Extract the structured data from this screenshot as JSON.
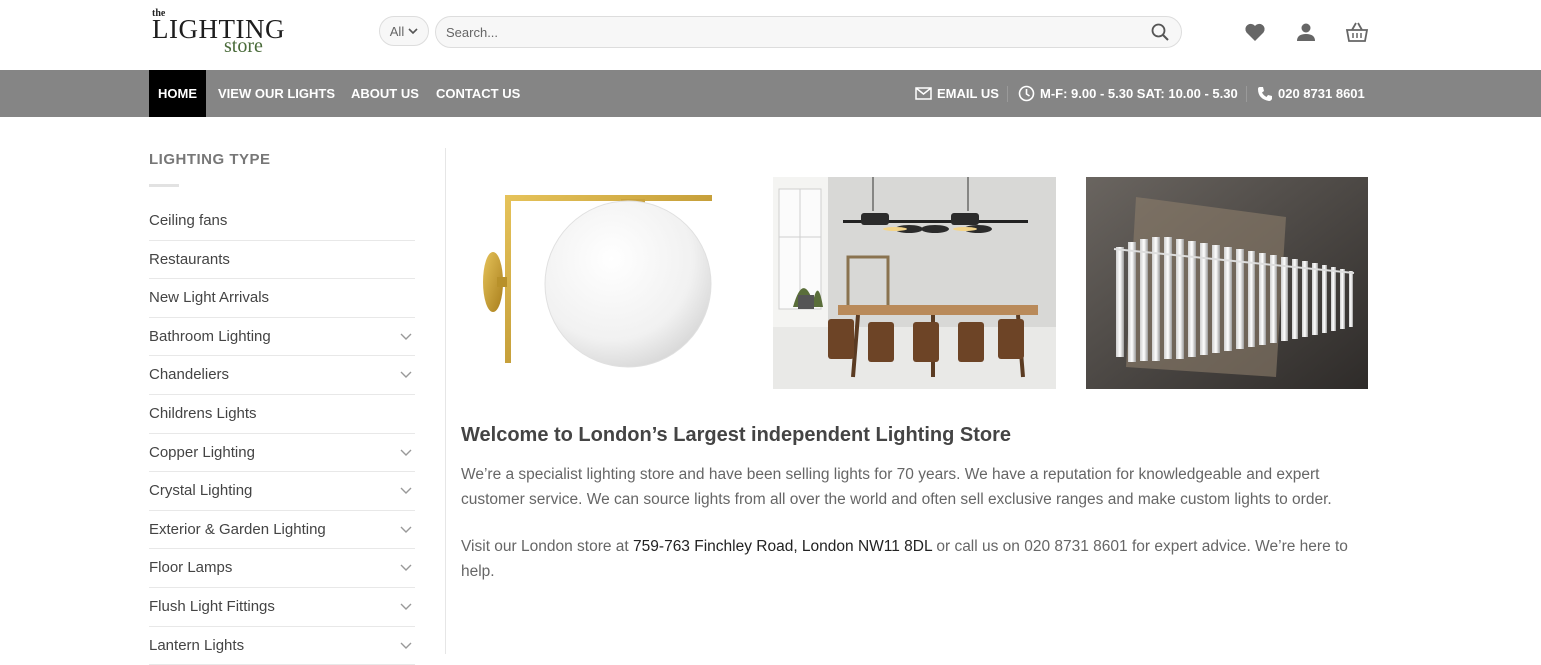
{
  "header": {
    "logo": {
      "the": "the",
      "lighting": "LIGHTING",
      "store": "store"
    },
    "search": {
      "category": "All",
      "placeholder": "Search..."
    },
    "icons": [
      "heart-icon",
      "user-icon",
      "basket-icon"
    ]
  },
  "nav": {
    "items": [
      {
        "label": "HOME",
        "active": true
      },
      {
        "label": "VIEW OUR LIGHTS",
        "active": false
      },
      {
        "label": "ABOUT US",
        "active": false
      },
      {
        "label": "CONTACT US",
        "active": false
      }
    ],
    "right": {
      "email": "EMAIL US",
      "hours": "M-F: 9.00 - 5.30 SAT: 10.00 - 5.30",
      "phone": "020 8731 8601"
    },
    "bar_color": "#858585",
    "active_color": "#000000"
  },
  "sidebar": {
    "title": "LIGHTING TYPE",
    "items": [
      {
        "label": "Ceiling fans",
        "expandable": false
      },
      {
        "label": "Restaurants",
        "expandable": false
      },
      {
        "label": "New Light Arrivals",
        "expandable": false
      },
      {
        "label": "Bathroom Lighting",
        "expandable": true
      },
      {
        "label": "Chandeliers",
        "expandable": true
      },
      {
        "label": "Childrens Lights",
        "expandable": false
      },
      {
        "label": "Copper Lighting",
        "expandable": true
      },
      {
        "label": "Crystal Lighting",
        "expandable": true
      },
      {
        "label": "Exterior & Garden Lighting",
        "expandable": true
      },
      {
        "label": "Floor Lamps",
        "expandable": true
      },
      {
        "label": "Flush Light Fittings",
        "expandable": true
      },
      {
        "label": "Lantern Lights",
        "expandable": true
      }
    ]
  },
  "main": {
    "images": [
      "brass-globe-wall-light",
      "black-linear-pendant-dining-room",
      "crystal-rod-chandelier"
    ],
    "heading": "Welcome to London’s Largest independent Lighting Store",
    "para1": "We’re a specialist lighting store and have been selling lights for 70 years. We have a reputation for knowledgeable and expert customer service.  We can source lights from all over the world and often sell exclusive ranges and make custom lights to order.",
    "para2_prefix": "Visit our London store at ",
    "para2_address": "759-763 Finchley Road, London NW11 8DL",
    "para2_suffix": " or call us on 020 8731 8601 for expert advice. We’re here to help."
  }
}
